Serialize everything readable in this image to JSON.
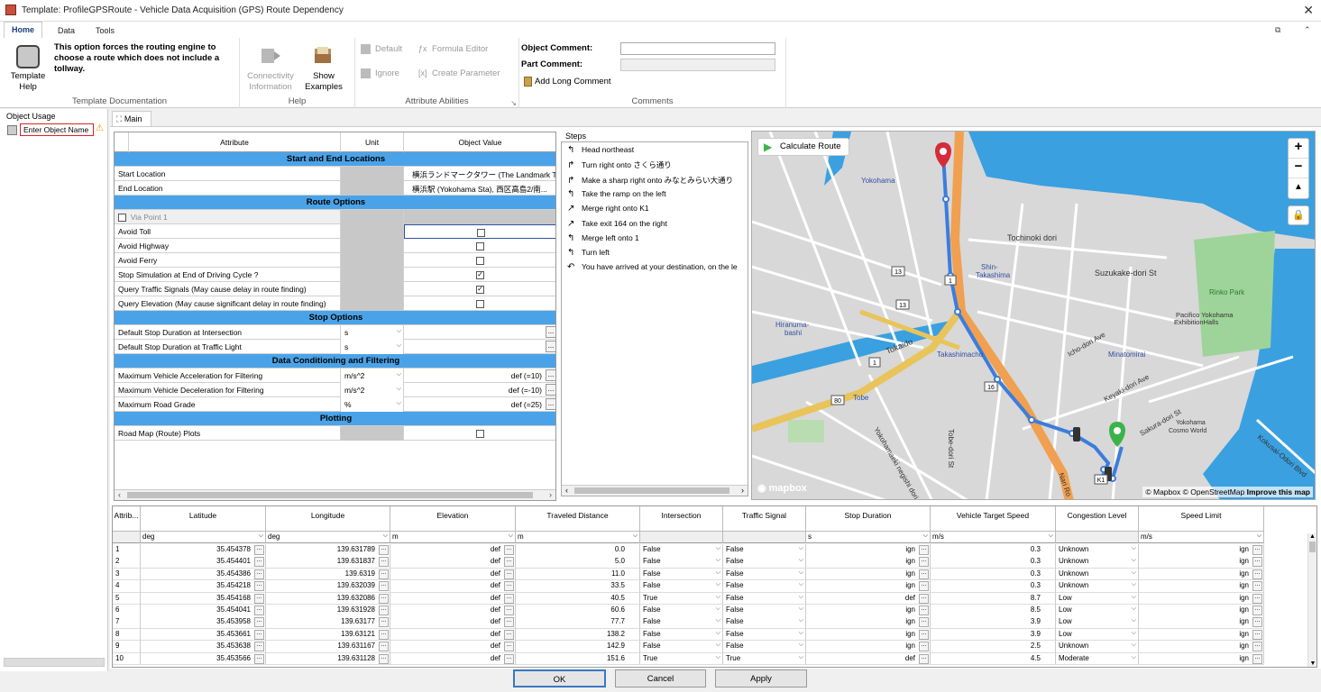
{
  "window": {
    "title": "Template: ProfileGPSRoute - Vehicle Data Acquisition (GPS) Route Dependency",
    "close": "✕"
  },
  "ribbon": {
    "tabs": [
      "Home",
      "Data",
      "Tools"
    ],
    "template_help": {
      "label1": "Template",
      "label2": "Help",
      "desc": "This option forces the routing engine to choose a route which does not include a tollway.",
      "group": "Template Documentation"
    },
    "help": {
      "conn1": "Connectivity",
      "conn2": "Information",
      "ex1": "Show",
      "ex2": "Examples",
      "group": "Help"
    },
    "attr": {
      "default": "Default",
      "formula": "Formula Editor",
      "ignore": "Ignore",
      "create": "Create Parameter",
      "group": "Attribute Abilities"
    },
    "comments": {
      "object": "Object Comment:",
      "part": "Part Comment:",
      "long": "Add Long Comment",
      "group": "Comments"
    }
  },
  "left": {
    "title": "Object Usage",
    "placeholder": "Enter Object Name"
  },
  "main_tab": "Main",
  "attr_grid": {
    "headers": [
      "Attribute",
      "Unit",
      "Object Value"
    ],
    "sections": {
      "s1": "Start and End Locations",
      "s2": "Route Options",
      "s3": "Stop Options",
      "s4": "Data Conditioning and Filtering",
      "s5": "Plotting"
    },
    "start": {
      "label": "Start Location",
      "value": "横浜ランドマークタワー (The Landmark To..."
    },
    "end": {
      "label": "End Location",
      "value": "横浜駅 (Yokohama Sta), 西区高島2/南..."
    },
    "via": "Via Point 1",
    "avoid_toll": "Avoid Toll",
    "avoid_hwy": "Avoid Highway",
    "avoid_ferry": "Avoid Ferry",
    "stop_sim": "Stop Simulation at End of Driving Cycle ?",
    "q_traffic": "Query Traffic Signals (May cause delay in route finding)",
    "q_elev": "Query Elevation (May cause significant delay in route finding)",
    "stop_int": "Default Stop Duration at Intersection",
    "stop_light": "Default Stop Duration at Traffic Light",
    "unit_s": "s",
    "max_acc": "Maximum Vehicle Acceleration for Filtering",
    "max_dec": "Maximum Vehicle Deceleration for Filtering",
    "max_grade": "Maximum Road Grade",
    "unit_ms2": "m/s^2",
    "unit_pct": "%",
    "acc_val": "def (=10)",
    "dec_val": "def (=-10)",
    "grade_val": "def (=25)",
    "road_map": "Road Map (Route) Plots"
  },
  "steps": {
    "title": "Steps",
    "items": [
      {
        "icon": "↰",
        "text": "Head northeast"
      },
      {
        "icon": "↱",
        "text": "Turn right onto さくら通り"
      },
      {
        "icon": "↱",
        "text": "Make a sharp right onto みなとみらい大通り"
      },
      {
        "icon": "↰",
        "text": "Take the ramp on the left"
      },
      {
        "icon": "↗",
        "text": "Merge right onto K1"
      },
      {
        "icon": "↗",
        "text": "Take exit 164 on the right"
      },
      {
        "icon": "↰",
        "text": "Merge left onto 1"
      },
      {
        "icon": "↰",
        "text": "Turn left"
      },
      {
        "icon": "↶",
        "text": "You have arrived at your destination, on the le"
      }
    ]
  },
  "map": {
    "calc": "Calculate Route",
    "zoom_in": "+",
    "zoom_out": "−",
    "compass": "▲",
    "attribution": "© Mapbox © OpenStreetMap",
    "improve": "Improve this map",
    "logo": "mapbox",
    "labels": {
      "yokohama": "Yokohama",
      "tochinoki": "Tochinoki dori",
      "suzukake": "Suzukake-dori St",
      "shintaka1": "Shin-",
      "shintaka2": "Takashima",
      "rinko": "Rinko Park",
      "pacifico1": "Pacifico Yokohama",
      "pacifico2": "ExhibitionHalls",
      "hiranuma1": "Hiranuma-",
      "hiranuma2": "bashi",
      "tokaido": "Tokaido",
      "takashimacho": "Takashimacho",
      "minatomirai": "Minatomirai",
      "tobe": "Tobe",
      "ichoori": "Icho-dori Ave",
      "keyaki": "Keyaki-dori Ave",
      "sakura": "Sakura-dori St",
      "cosmo1": "Yokohama",
      "cosmo2": "Cosmo World",
      "kokusai": "Kokusai-Odori Blvd",
      "narl": "Nari Ro",
      "ymaeki": "Yokohamaeki negishi dori",
      "tobedori": "Tobe-dori St",
      "r13": "13",
      "r1": "1",
      "r16": "16",
      "r80": "80",
      "k1": "K1"
    }
  },
  "table": {
    "headers": [
      "Attrib...",
      "Latitude",
      "Longitude",
      "Elevation",
      "Traveled Distance",
      "Intersection",
      "Traffic Signal",
      "Stop Duration",
      "Vehicle Target Speed",
      "Congestion Level",
      "Speed Limit"
    ],
    "units": [
      "",
      "deg",
      "deg",
      "m",
      "m",
      "",
      "",
      "s",
      "m/s",
      "",
      "m/s"
    ],
    "rows": [
      {
        "n": "1",
        "lat": "35.454378",
        "lon": "139.631789",
        "el": "def",
        "td": "0.0",
        "int": "False",
        "ts": "False",
        "sd": "ign",
        "vs": "0.3",
        "cl": "Unknown",
        "sl": "ign"
      },
      {
        "n": "2",
        "lat": "35.454401",
        "lon": "139.631837",
        "el": "def",
        "td": "5.0",
        "int": "False",
        "ts": "False",
        "sd": "ign",
        "vs": "0.3",
        "cl": "Unknown",
        "sl": "ign"
      },
      {
        "n": "3",
        "lat": "35.454386",
        "lon": "139.6319",
        "el": "def",
        "td": "11.0",
        "int": "False",
        "ts": "False",
        "sd": "ign",
        "vs": "0.3",
        "cl": "Unknown",
        "sl": "ign"
      },
      {
        "n": "4",
        "lat": "35.454218",
        "lon": "139.632039",
        "el": "def",
        "td": "33.5",
        "int": "False",
        "ts": "False",
        "sd": "ign",
        "vs": "0.3",
        "cl": "Unknown",
        "sl": "ign"
      },
      {
        "n": "5",
        "lat": "35.454168",
        "lon": "139.632086",
        "el": "def",
        "td": "40.5",
        "int": "True",
        "ts": "False",
        "sd": "def",
        "vs": "8.7",
        "cl": "Low",
        "sl": "ign"
      },
      {
        "n": "6",
        "lat": "35.454041",
        "lon": "139.631928",
        "el": "def",
        "td": "60.6",
        "int": "False",
        "ts": "False",
        "sd": "ign",
        "vs": "8.5",
        "cl": "Low",
        "sl": "ign"
      },
      {
        "n": "7",
        "lat": "35.453958",
        "lon": "139.63177",
        "el": "def",
        "td": "77.7",
        "int": "False",
        "ts": "False",
        "sd": "ign",
        "vs": "3.9",
        "cl": "Low",
        "sl": "ign"
      },
      {
        "n": "8",
        "lat": "35.453661",
        "lon": "139.63121",
        "el": "def",
        "td": "138.2",
        "int": "False",
        "ts": "False",
        "sd": "ign",
        "vs": "3.9",
        "cl": "Low",
        "sl": "ign"
      },
      {
        "n": "9",
        "lat": "35.453638",
        "lon": "139.631167",
        "el": "def",
        "td": "142.9",
        "int": "False",
        "ts": "False",
        "sd": "ign",
        "vs": "2.5",
        "cl": "Unknown",
        "sl": "ign"
      },
      {
        "n": "10",
        "lat": "35.453566",
        "lon": "139.631128",
        "el": "def",
        "td": "151.6",
        "int": "True",
        "ts": "True",
        "sd": "def",
        "vs": "4.5",
        "cl": "Moderate",
        "sl": "ign"
      }
    ]
  },
  "buttons": {
    "ok": "OK",
    "cancel": "Cancel",
    "apply": "Apply"
  },
  "colors": {
    "section": "#4aa3e8",
    "route": "#3b7ddd",
    "highway": "#f0a050",
    "water": "#3aa0e0"
  }
}
